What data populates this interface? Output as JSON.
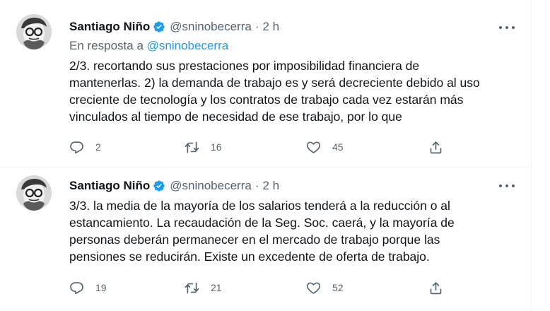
{
  "tweets": [
    {
      "author_name": "Santiago Niño",
      "handle": "@sninobecerra",
      "separator": "·",
      "time": "2 h",
      "reply_prefix": "En resposta a",
      "reply_handle": "@sninobecerra",
      "text": "2/3. recortando sus prestaciones por imposibilidad financiera de\nmantenerlas. 2) la demanda de trabajo es y será decreciente debido al uso\ncreciente de tecnología y los contratos de trabajo cada vez estarán más\nvinculados al tiempo de necesidad de ese trabajo, por lo que",
      "replies": "2",
      "retweets": "16",
      "likes": "45",
      "icons": [
        "verified-badge-icon",
        "more-icon",
        "reply-icon",
        "retweet-icon",
        "like-icon",
        "share-icon"
      ]
    },
    {
      "author_name": "Santiago Niño",
      "handle": "@sninobecerra",
      "separator": "·",
      "time": "2 h",
      "text": "3/3. la media de la mayoría de los salarios tenderá a la reducción o al\nestancamiento. La recaudación de la Seg. Soc. caerá, y la mayoría de\npersonas deberán permanecer en el mercado de trabajo porque las\npensiones se reducirán. Existe un excedente de oferta de  trabajo.",
      "replies": "19",
      "retweets": "21",
      "likes": "52",
      "icons": [
        "verified-badge-icon",
        "more-icon",
        "reply-icon",
        "retweet-icon",
        "like-icon",
        "share-icon"
      ]
    }
  ],
  "colors": {
    "text": "#0f1419",
    "secondary": "#536471",
    "link": "#1d9bf0",
    "verified": "#1d9bf0",
    "border": "#eff3f4"
  }
}
